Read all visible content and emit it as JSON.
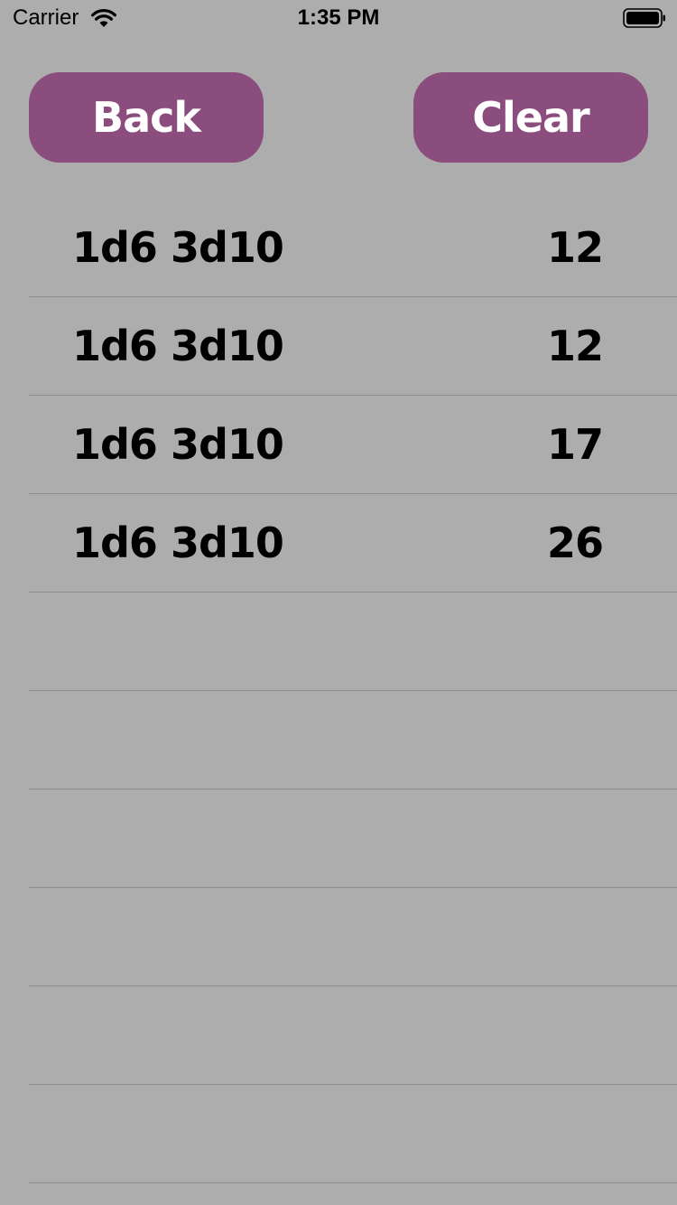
{
  "status_bar": {
    "carrier": "Carrier",
    "time": "1:35 PM",
    "wifi_icon": "wifi-icon",
    "battery_icon": "battery-icon"
  },
  "toolbar": {
    "back_label": "Back",
    "clear_label": "Clear",
    "button_color": "#8a4d7e",
    "background_color": "#adadad"
  },
  "history": {
    "items": [
      {
        "expression": "1d6 3d10",
        "total": "12"
      },
      {
        "expression": "1d6 3d10",
        "total": "12"
      },
      {
        "expression": "1d6 3d10",
        "total": "17"
      },
      {
        "expression": "1d6 3d10",
        "total": "26"
      },
      {
        "expression": "",
        "total": ""
      },
      {
        "expression": "",
        "total": ""
      },
      {
        "expression": "",
        "total": ""
      },
      {
        "expression": "",
        "total": ""
      },
      {
        "expression": "",
        "total": ""
      },
      {
        "expression": "",
        "total": ""
      }
    ]
  }
}
